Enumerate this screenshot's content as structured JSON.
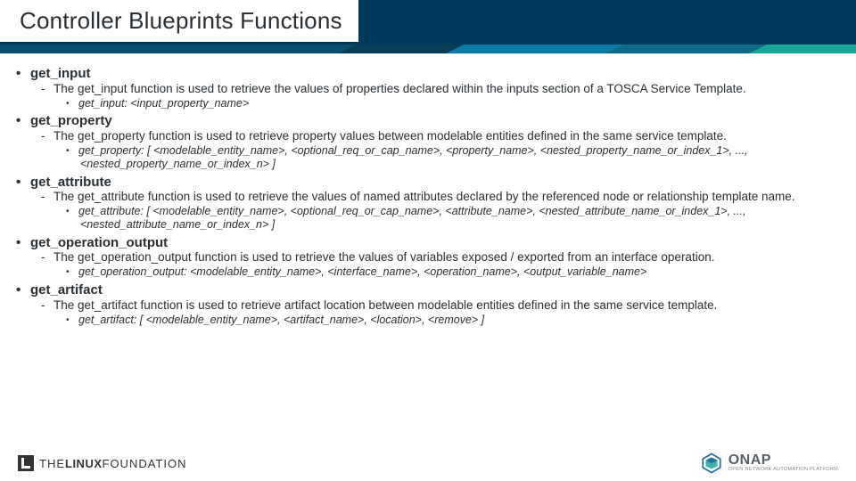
{
  "title": "Controller Blueprints Functions",
  "functions": [
    {
      "name": "get_input",
      "desc": "The get_input function is used to retrieve the values of properties declared within the inputs section of a TOSCA Service Template.",
      "syntax": "get_input: <input_property_name>"
    },
    {
      "name": "get_property",
      "desc": "The get_property function is used to retrieve property values between modelable entities defined in the same service template.",
      "syntax": "get_property: [ <modelable_entity_name>, <optional_req_or_cap_name>, <property_name>, <nested_property_name_or_index_1>, ..., <nested_property_name_or_index_n> ]"
    },
    {
      "name": "get_attribute",
      "desc": "The get_attribute function is used to retrieve the values of named attributes declared by the referenced node or relationship template name.",
      "syntax": "get_attribute: [ <modelable_entity_name>, <optional_req_or_cap_name>, <attribute_name>, <nested_attribute_name_or_index_1>, ..., <nested_attribute_name_or_index_n> ]"
    },
    {
      "name": "get_operation_output",
      "desc": "The get_operation_output function is used to retrieve the values of variables exposed / exported from an interface operation.",
      "syntax": "get_operation_output: <modelable_entity_name>, <interface_name>, <operation_name>, <output_variable_name>"
    },
    {
      "name": "get_artifact",
      "desc": "The get_artifact function is used to retrieve artifact location between modelable entities defined in the same service template.",
      "syntax": "get_artifact: [ <modelable_entity_name>, <artifact_name>, <location>, <remove> ]"
    }
  ],
  "footer": {
    "lf_the": "THE",
    "lf_linux": "LINUX",
    "lf_foundation": "FOUNDATION",
    "onap_big": "ONAP",
    "onap_small": "OPEN NETWORK AUTOMATION PLATFORM"
  }
}
